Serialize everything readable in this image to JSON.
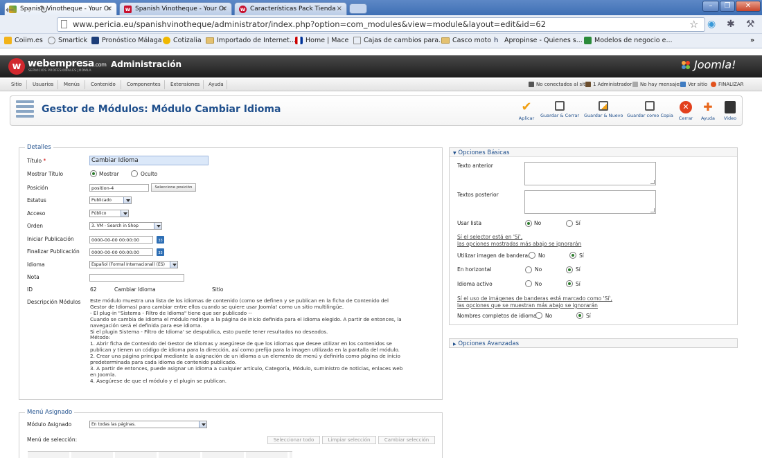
{
  "browser": {
    "tabs": [
      {
        "title": "Spanish Vinotheque - Your Or",
        "active": true
      },
      {
        "title": "Spanish Vinotheque - Your Or",
        "active": false
      },
      {
        "title": "Características Pack Tienda -",
        "active": false
      }
    ],
    "url": "www.pericia.eu/spanishvinotheque/administrator/index.php?option=com_modules&view=module&layout=edit&id=62",
    "bookmarks": [
      "Coiim.es",
      "Smartick",
      "Pronóstico Málaga",
      "Cotizalia",
      "Importado de Internet...",
      "Home | Mace",
      "Cajas de cambios para...",
      "Casco moto",
      "Apropinse - Quienes s...",
      "Modelos de negocio e..."
    ]
  },
  "header": {
    "brand": "webempresa",
    "brand_suffix": ".com",
    "brand_sub": "SERVICIOS PROFESIONALES JOOMLA",
    "admin_title": "Administración",
    "joomla": "Joomla!"
  },
  "menu": {
    "items": [
      "Sitio",
      "Usuarios",
      "Menús",
      "Contenido",
      "Componentes",
      "Extensiones",
      "Ayuda"
    ],
    "status": [
      "No conectados al sitio",
      "1 Administrador",
      "No hay mensajes",
      "Ver sitio",
      "FINALIZAR"
    ]
  },
  "toolbar": {
    "title": "Gestor de Módulos: Módulo Cambiar Idioma",
    "buttons": [
      "Aplicar",
      "Guardar & Cerrar",
      "Guardar & Nuevo",
      "Guardar como Copia",
      "Cerrar",
      "Ayuda",
      "Video"
    ]
  },
  "details": {
    "legend": "Detalles",
    "title_label": "Título",
    "title_required": "*",
    "title_value": "Cambiar Idioma",
    "show_title_label": "Mostrar Título",
    "show_opt": "Mostrar",
    "hide_opt": "Oculto",
    "position_label": "Posición",
    "position_value": "position-4",
    "position_btn": "Seleccione posición",
    "status_label": "Estatus",
    "status_value": "Publicado",
    "access_label": "Acceso",
    "access_value": "Público",
    "order_label": "Orden",
    "order_value": "3. VM - Search in Shop",
    "start_label": "Iniciar Publicación",
    "start_value": "0000-00-00 00:00:00",
    "end_label": "Finalizar Publicación",
    "end_value": "0000-00-00 00:00:00",
    "lang_label": "Idioma",
    "lang_value": "Español (Formal Internacional) (ES)",
    "note_label": "Nota",
    "id_label": "ID",
    "id_value": "62",
    "id_name": "Cambiar Idioma",
    "id_site": "Sitio",
    "desc_label": "Descripción Módulos",
    "description": [
      "Este módulo muestra una lista de los idiomas de contenido (como se definen y se publican en la ficha de Contenido del",
      "Gestor de Idiomas) para cambiar entre ellos cuando se quiere usar Joomla! como un sitio multilingüe.",
      "- El plug-in \"Sistema - Filtro de Idioma\" tiene que ser publicado --",
      "Cuando se cambia de idioma el módulo redirige a la página de inicio definida para el idioma elegido. A partir de entonces, la",
      "navegación será el definida para ese idioma.",
      "Si el plugin Sistema - Filtro de Idioma' se despublica, esto puede tener resultados no deseados.",
      "Método:",
      "1. Abrir ficha de Contenido del Gestor de Idiomas y asegúrese de que los idiomas que desee utilizar en los contenidos se",
      "publican y tienen un código de idioma para la dirección, así como prefijo para la imagen utilizada en la pantalla del módulo.",
      "2. Crear una página principal mediante la asignación de un idioma a un elemento de menú y definirla como página de inicio",
      "predeterminada para cada idioma de contenido publicado.",
      "3. A partir de entonces, puede asignar un idioma a cualquier artículo, Categoría, Módulo, suministro de noticias, enlaces web",
      "en Joomla.",
      "4. Asegúrese de que el módulo y el plugin se publican."
    ]
  },
  "menu_assign": {
    "legend": "Menú Asignado",
    "module_label": "Módulo Asignado",
    "module_value": "En todas las páginas.",
    "selection_label": "Menú de selección:",
    "btn_select_all": "Seleccionar todo",
    "btn_clear": "Limpiar selección",
    "btn_toggle": "Cambiar selección"
  },
  "basic": {
    "heading": "Opciones Básicas",
    "text_before": "Texto anterior",
    "text_after": "Textos posterior",
    "use_list": "Usar lista",
    "no": "No",
    "yes": "Sí",
    "note1_a": "Sí el selector está en 'Sí',",
    "note1_b": "las opciones mostradas más abajo se ignorarán",
    "flags": "Utilizar imagen de banderas",
    "horizontal": "En horizontal",
    "active": "Idioma activo",
    "note2_a": "Sí el uso de imágenes de banderas está marcado como 'Sí',",
    "note2_b": "las opciones que se muestran más abajo se ignorarán",
    "full_names": "Nombres completos de idioma"
  },
  "advanced": {
    "heading": "Opciones Avanzadas"
  }
}
